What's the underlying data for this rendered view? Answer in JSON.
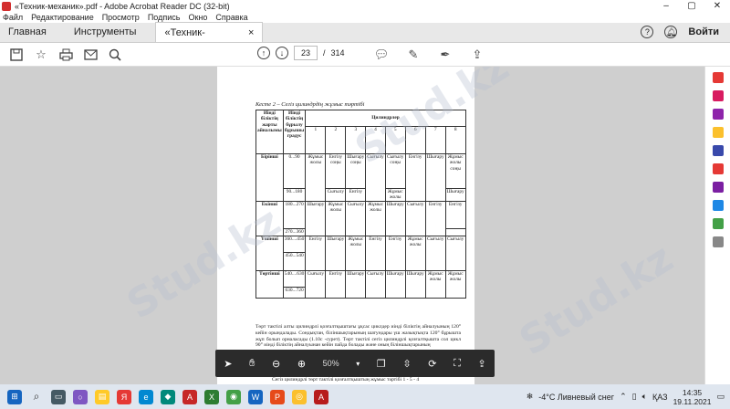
{
  "window": {
    "title": "«Техник-механик».pdf - Adobe Acrobat Reader DC (32-bit)"
  },
  "menu": [
    "Файл",
    "Редактирование",
    "Просмотр",
    "Подпись",
    "Окно",
    "Справка"
  ],
  "tabs": {
    "home": "Главная",
    "tools": "Инструменты",
    "document": "«Техник-механик»...",
    "close": "×"
  },
  "header": {
    "login": "Войти"
  },
  "pager": {
    "current": "23",
    "separator": "/",
    "total": "314"
  },
  "document": {
    "caption": "Кесте 2 – Сегіз цилиндрдің жұмыс тәртібі",
    "col_headers": {
      "c1": "Иінді біліктің жарты айналымы",
      "c2": "Иінді біліктің бұрылу бұрышы градус",
      "c3": "Цилиндрлер"
    },
    "cyl_nums": [
      "1",
      "2",
      "3",
      "4",
      "5",
      "6",
      "7",
      "8"
    ],
    "rows": {
      "r1": {
        "half": "Бірінші",
        "deg_a": "0...90",
        "deg_b": "90...180",
        "c": [
          "Жұмыс жолы",
          "Енгізу соңы",
          "Шығару соңы",
          "Сығылу",
          "Сығылу соңы",
          "Енгізу",
          "Шығару",
          "Жұмыс жолы соңы"
        ],
        "extra": [
          "Сығылу",
          "Енгізу",
          "Жұмыс жолы",
          "Шығару"
        ]
      },
      "r2": {
        "half": "Екінші",
        "deg_a": "180...270",
        "deg_b": "270...360",
        "c": [
          "Шығару",
          "Жұмыс жолы",
          "Сығылу",
          "Жұмыс жолы",
          "Шығару",
          "Сығылу",
          "Енгізу",
          "Енгізу"
        ]
      },
      "r3": {
        "half": "Үшінші",
        "deg_a": "360....450",
        "deg_b": "450...540",
        "c": [
          "Енгізу",
          "Шығару",
          "Жұмыс жолы",
          "Енгізу",
          "Енгізу",
          "Жұмыс жолы",
          "Сығылу",
          "Сығылу"
        ]
      },
      "r4": {
        "half": "Төртінші",
        "deg_a": "540....630",
        "deg_b": "630...720",
        "c": [
          "Сығылу",
          "Енгізу",
          "Шығару",
          "Сығылу",
          "Шығару",
          "Шығару",
          "Жұмыс жолы",
          "Жұмыс жолы"
        ]
      }
    },
    "paragraph": "Төрт тактілі алты цилиндрлі қозғалтқыштағы ұқсас циклдер иінді біліктің айналуының 120° кейін орындалады. Сондықтан, біліншықтарының шатундары үш жазықтықта 120° бұрышта жұп болып орналасады (1.10с -сурет). Төрт тактілі сегіз цилиндрлі қозғалтқышта сол цикл 90° иінді біліктің айналуынан кейін пайда болады және оның біліншықтарының",
    "paragraph2": "Сегіз цилиндрлі төрт тактілі қозғалтқыштың жұмыс тәртібі 1 - 5 - 4"
  },
  "floatbar": {
    "zoom": "50%"
  },
  "taskbar": {
    "weather": "-4°C Ливневый снег",
    "lang": "ҚАЗ",
    "time": "14:35",
    "date": "19.11.2021"
  },
  "watermark": "Stud.kz"
}
